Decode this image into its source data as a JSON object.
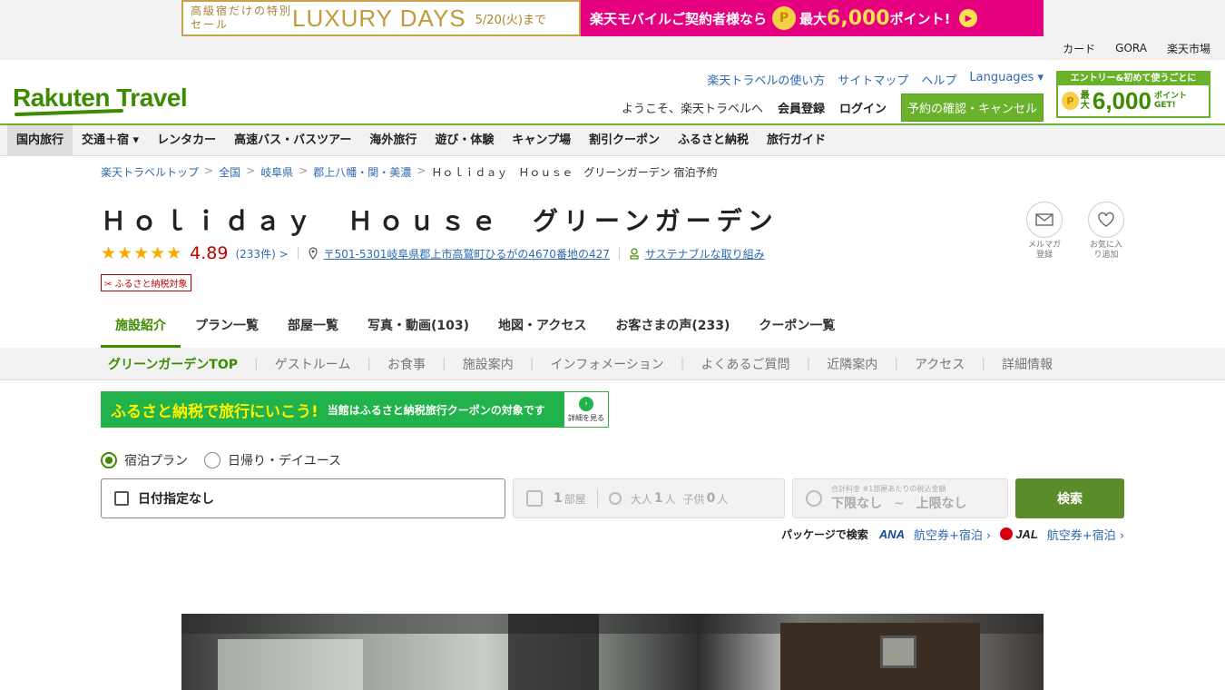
{
  "banner": {
    "left_small": "高級宿だけの特別セール",
    "left_big": "LUXURY DAYS",
    "left_date": "5/20(火)まで",
    "right_text": "楽天モバイルご契約者様なら",
    "coin": "P",
    "right_max": "最大",
    "right_points": "6,000",
    "right_suffix": "ポイント!",
    "play": "▶"
  },
  "util_links": [
    "カード",
    "GORA",
    "楽天市場"
  ],
  "header": {
    "logo": "Rakuten Travel",
    "links": [
      "楽天トラベルの使い方",
      "サイトマップ",
      "ヘルプ",
      "Languages ▾"
    ],
    "welcome": "ようこそ、楽天トラベルへ",
    "register": "会員登録",
    "login": "ログイン",
    "reserve_button": "予約の確認・キャンセル",
    "entry": {
      "title": "エントリー&初めて使うごとに",
      "coin": "P",
      "max": "最大",
      "points": "6,000",
      "suffix": "ポイントGET!"
    }
  },
  "main_nav": [
    "国内旅行",
    "交通＋宿 ▾",
    "レンタカー",
    "高速バス・バスツアー",
    "海外旅行",
    "遊び・体験",
    "キャンプ場",
    "割引クーポン",
    "ふるさと納税",
    "旅行ガイド"
  ],
  "breadcrumb": [
    "楽天トラベルトップ",
    "全国",
    "岐阜県",
    "郡上八幡・関・美濃"
  ],
  "breadcrumb_current": "Ｈｏｌｉｄａｙ　Ｈｏｕｓｅ　グリーンガーデン 宿泊予約",
  "breadcrumb_sep": ">",
  "hotel": {
    "name": "Ｈｏｌｉｄａｙ　Ｈｏｕｓｅ　グリーンガーデン",
    "stars": "★★★★★",
    "score": "4.89",
    "reviews": "(233件) >",
    "address": "〒501-5301岐阜県郡上市高鷲町ひるがの4670番地の427",
    "sustainable": "サステナブルな取り組み",
    "furusato_tag": "✂ ふるさと納税対象",
    "mail_label": "メルマガ登録",
    "fav_label": "お気に入り追加"
  },
  "tabs": [
    "施設紹介",
    "プラン一覧",
    "部屋一覧",
    "写真・動画(103)",
    "地図・アクセス",
    "お客さまの声(233)",
    "クーポン一覧"
  ],
  "sub_nav": [
    "グリーンガーデンTOP",
    "ゲストルーム",
    "お食事",
    "施設案内",
    "インフォメーション",
    "よくあるご質問",
    "近隣案内",
    "アクセス",
    "詳細情報"
  ],
  "sub_nav_sep": "|",
  "furusato_banner": {
    "big": "ふるさと納税で旅行にいこう!",
    "text": "当館はふるさと納税旅行クーポンの対象です",
    "more": "詳細を見る",
    "more_arrow": "›"
  },
  "search": {
    "radio_stay": "宿泊プラン",
    "radio_day": "日帰り・デイユース",
    "date_value": "日付指定なし",
    "rooms_num": "1",
    "rooms_unit": "部屋",
    "adults_label": "大人",
    "adults_num": "1",
    "adults_unit": "人",
    "children_label": "子供",
    "children_num": "0",
    "children_unit": "人",
    "price_caption": "合計料金 ※1部屋あたりの税込金額",
    "price_min": "下限なし",
    "price_sep": "~",
    "price_max": "上限なし",
    "button": "検索"
  },
  "package": {
    "label": "パッケージで検索",
    "ana": "ANA",
    "ana_link": "航空券+宿泊 ›",
    "jal": "JAL",
    "jal_link": "航空券+宿泊 ›"
  }
}
